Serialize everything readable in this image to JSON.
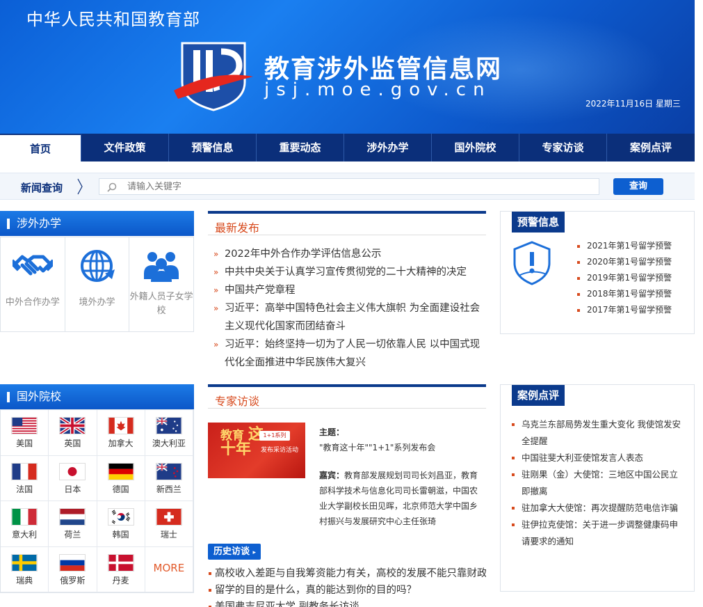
{
  "header": {
    "ministry": "中华人民共和国教育部",
    "site_title": "教育涉外监管信息网",
    "site_url": "jsj.moe.gov.cn",
    "date": "2022年11月16日  星期三"
  },
  "nav": {
    "items": [
      "首页",
      "文件政策",
      "预警信息",
      "重要动态",
      "涉外办学",
      "国外院校",
      "专家访谈",
      "案例点评"
    ]
  },
  "search": {
    "label": "新闻查询",
    "placeholder": "请输入关键字",
    "button": "查询"
  },
  "abroad": {
    "title": "涉外办学",
    "items": [
      {
        "label": "中外合作办学",
        "icon": "handshake-icon"
      },
      {
        "label": "境外办学",
        "icon": "globe-icon"
      },
      {
        "label": "外籍人员子女学校",
        "icon": "people-icon"
      }
    ]
  },
  "colleges": {
    "title": "国外院校",
    "countries": [
      "美国",
      "英国",
      "加拿大",
      "澳大利亚",
      "法国",
      "日本",
      "德国",
      "新西兰",
      "意大利",
      "荷兰",
      "韩国",
      "瑞士",
      "瑞典",
      "俄罗斯",
      "丹麦"
    ],
    "more": "MORE"
  },
  "latest": {
    "title": "最新发布",
    "items": [
      "2022年中外合作办学评估信息公示",
      "中共中央关于认真学习宣传贯彻党的二十大精神的决定",
      "中国共产党章程",
      "习近平：高举中国特色社会主义伟大旗帜 为全面建设社会主义现代化国家而团结奋斗",
      "习近平：始终坚持一切为了人民一切依靠人民 以中国式现代化全面推进中华民族伟大复兴"
    ]
  },
  "interview": {
    "title": "专家访谈",
    "img_text1": "教育",
    "img_text2": "这",
    "img_text3": "十年",
    "img_badge": "1+1系列",
    "img_sub": "发布采访活动",
    "topic_label": "主题：",
    "topic": "\"教育这十年\"\"1+1\"系列发布会",
    "guest_label": "嘉宾：",
    "guests": "教育部发展规划司司长刘昌亚，教育部科学技术与信息化司司长雷朝滋，中国农业大学副校长田见晖，北京师范大学中国乡村振兴与发展研究中心主任张琦",
    "history_btn": "历史访谈",
    "history": [
      "高校收入差距与自我筹资能力有关，高校的发展不能只靠财政",
      "留学的目的是什么，真的能达到你的目的吗？",
      "美国弗吉尼亚大学 副教务长访谈"
    ]
  },
  "warnings": {
    "title": "预警信息",
    "items": [
      "2021年第1号留学预警",
      "2020年第1号留学预警",
      "2019年第1号留学预警",
      "2018年第1号留学预警",
      "2017年第1号留学预警"
    ]
  },
  "cases": {
    "title": "案例点评",
    "items": [
      "乌克兰东部局势发生重大变化 我使馆发安全提醒",
      "中国驻斐大利亚使馆发言人表态",
      "驻刚果（金）大使馆：三地区中国公民立即撤离",
      "驻加拿大大使馆：再次提醒防范电信诈骗",
      "驻伊拉克使馆：关于进一步调整健康码申请要求的通知"
    ]
  },
  "colors": {
    "nav_bg": "#0b2f7a",
    "accent": "#d74a1d",
    "button": "#0d5fd0"
  }
}
